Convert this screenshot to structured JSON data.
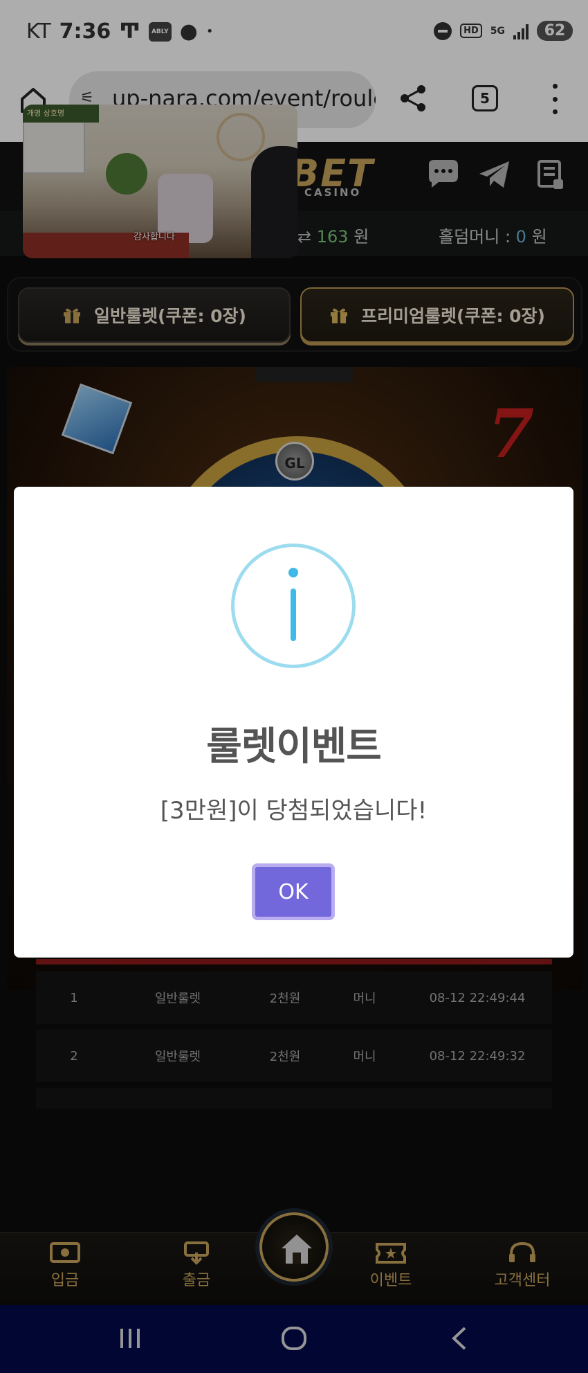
{
  "status_bar": {
    "carrier": "KT",
    "time": "7:36",
    "app_badge": "ABLY",
    "battery": "62",
    "network": "5G",
    "hd": "HD"
  },
  "browser": {
    "url": "up-nara.com/event/roulette",
    "tab_count": "5"
  },
  "site": {
    "logo": "BET",
    "logo_sub": "CASINO",
    "balance": {
      "money_value": "163",
      "money_unit": "원",
      "holdem_label": "홀덤머니 : ",
      "holdem_value": "0",
      "holdem_unit": "원"
    },
    "tabs": [
      {
        "label": "일반룰렛(쿠폰: 0장)"
      },
      {
        "label": "프리미엄룰렛(쿠폰: 0장)"
      }
    ],
    "wheel_badge": "GL",
    "history": [
      {
        "no": "1",
        "type": "일반룰렛",
        "prize": "2천원",
        "kind": "머니",
        "date": "08-12 22:49:44"
      },
      {
        "no": "2",
        "type": "일반룰렛",
        "prize": "2천원",
        "kind": "머니",
        "date": "08-12 22:49:32"
      }
    ]
  },
  "bottom_nav": [
    {
      "label": "입금"
    },
    {
      "label": "출금"
    },
    {
      "label": "이벤트"
    },
    {
      "label": "고객센터"
    }
  ],
  "pip": {
    "caption": "감사합니다",
    "sign_text": "개명 상호명"
  },
  "modal": {
    "title": "룰렛이벤트",
    "message": "[3만원]이 당첨되었습니다!",
    "ok_label": "OK"
  },
  "colors": {
    "accent_gold": "#c9a45c",
    "modal_button": "#7367dc",
    "info_icon": "#3fb9e7"
  }
}
